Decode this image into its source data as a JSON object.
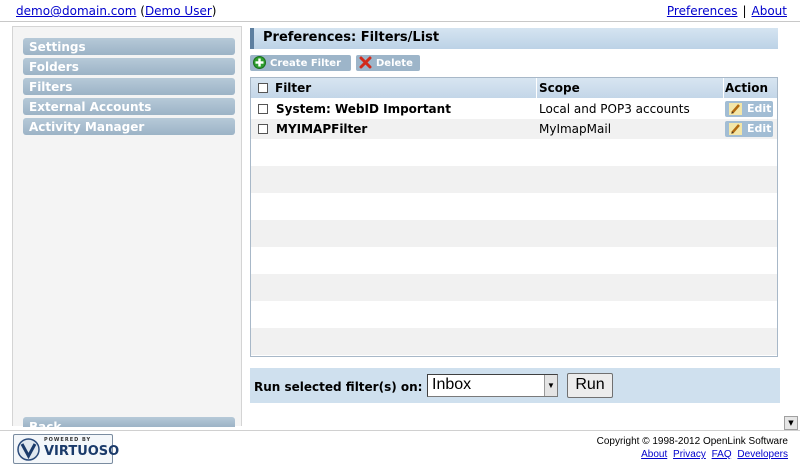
{
  "header": {
    "user_email": "demo@domain.com",
    "user_name": "Demo User",
    "links": [
      "Preferences",
      "About"
    ],
    "separator": "|"
  },
  "sidebar": {
    "items": [
      {
        "label": "Settings"
      },
      {
        "label": "Folders"
      },
      {
        "label": "Filters"
      },
      {
        "label": "External Accounts"
      },
      {
        "label": "Activity Manager"
      }
    ],
    "back_label": "Back"
  },
  "main": {
    "title": "Preferences: Filters/List",
    "toolbar": {
      "create_label": "Create Filter",
      "delete_label": "Delete",
      "create_icon": "plus-icon",
      "delete_icon": "x-icon"
    },
    "table": {
      "columns": [
        "Filter",
        "Scope",
        "Action"
      ],
      "rows": [
        {
          "filter": "System: WebID Important",
          "scope": "Local and POP3 accounts",
          "action": "Edit"
        },
        {
          "filter": "MYIMAPFilter",
          "scope": "MyImapMail",
          "action": "Edit"
        }
      ]
    },
    "run": {
      "label": "Run selected filter(s) on:",
      "selected_folder": "Inbox",
      "button_label": "Run"
    }
  },
  "footer": {
    "logo_powered": "POWERED BY",
    "logo_name": "VIRTUOSO",
    "copyright": "Copyright © 1998-2012 OpenLink Software",
    "links": [
      "About",
      "Privacy",
      "FAQ",
      "Developers"
    ]
  },
  "colors": {
    "nav_bg": "#9cb3c6",
    "title_bar": "#c8dbeb",
    "link": "#0000cc"
  }
}
